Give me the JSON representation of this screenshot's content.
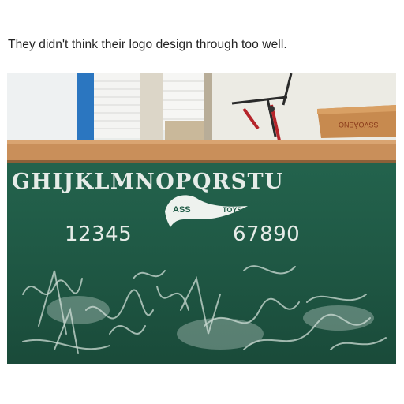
{
  "caption": "They didn't think their logo design through too well.",
  "photo": {
    "board_letters": "GHIJKLMNOPQRSTU",
    "numbers_left": "12345",
    "numbers_right": "67890",
    "logo": {
      "text_main": "ASS",
      "text_secondary": "TOYS",
      "full_brand": "CASS TOYS"
    },
    "box_print": "SSVOÀENO",
    "colors": {
      "chalkboard": "#1f5b46",
      "frame_wood": "#c98f5a",
      "chalk": "#e6ece8"
    }
  }
}
